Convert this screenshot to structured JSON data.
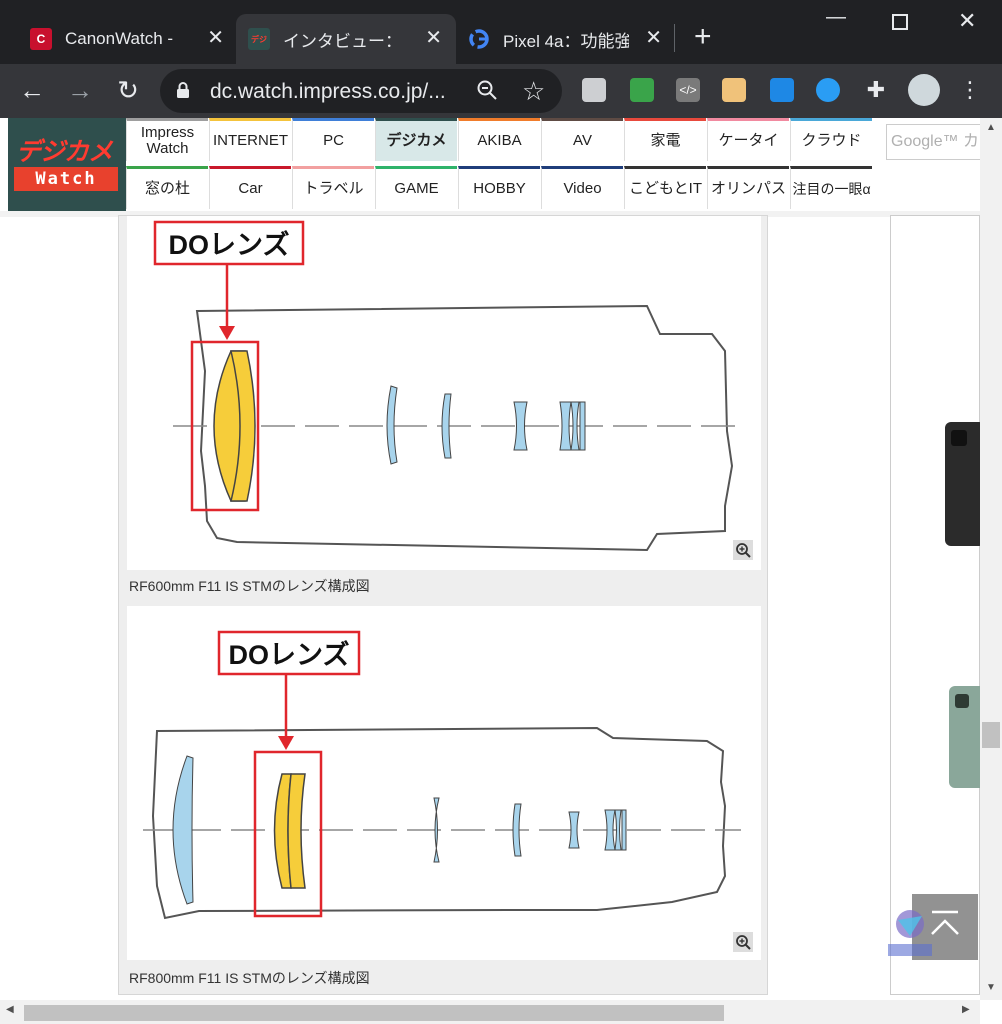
{
  "browser": {
    "tabs": [
      {
        "title": "CanonWatch - ",
        "favicon": "canonwatch-icon"
      },
      {
        "title": "インタビュー：",
        "favicon": "dcwatch-icon"
      },
      {
        "title": "Pixel 4a：功能強",
        "favicon": "google-icon"
      }
    ],
    "address": {
      "url": "dc.watch.impress.co.jp/..."
    }
  },
  "site": {
    "logo_top": "デジカメ",
    "logo_bottom": "Watch",
    "nav_row1": [
      {
        "label": "Impress Watch",
        "color": "#9e9e9e"
      },
      {
        "label": "INTERNET",
        "color": "#f4c33c"
      },
      {
        "label": "PC",
        "color": "#3f7fd8"
      },
      {
        "label": "デジカメ",
        "color": "#2f4f4d"
      },
      {
        "label": "AKIBA",
        "color": "#f07c2b"
      },
      {
        "label": "AV",
        "color": "#5e4b44"
      },
      {
        "label": "家電",
        "color": "#e8493c"
      },
      {
        "label": "ケータイ",
        "color": "#f18aa0"
      },
      {
        "label": "クラウド",
        "color": "#4aa8d8"
      }
    ],
    "nav_row2": [
      {
        "label": "窓の杜",
        "color": "#3aa44a"
      },
      {
        "label": "Car",
        "color": "#c9182b"
      },
      {
        "label": "トラベル",
        "color": "#f2a0a0"
      },
      {
        "label": "GAME",
        "color": "#2fb36a"
      },
      {
        "label": "HOBBY",
        "color": "#1f3d7a"
      },
      {
        "label": "Video",
        "color": "#1f3d7a"
      },
      {
        "label": "こどもとIT",
        "color": "#333333"
      },
      {
        "label": "オリンパス",
        "color": "#333333"
      },
      {
        "label": "注目の一眼α",
        "color": "#333333"
      }
    ],
    "search_placeholder": "Google™ カスタム検索"
  },
  "figures": [
    {
      "label": "DOレンズ",
      "caption": "RF600mm F11 IS STMのレンズ構成図"
    },
    {
      "label": "DOレンズ",
      "caption": "RF800mm F11 IS STMのレンズ構成図"
    }
  ]
}
